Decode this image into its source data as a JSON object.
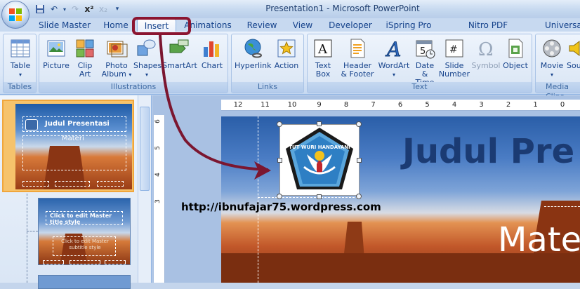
{
  "window": {
    "title": "Presentation1 - Microsoft PowerPoint"
  },
  "tabs": [
    {
      "label": "Slide Master"
    },
    {
      "label": "Home"
    },
    {
      "label": "Insert"
    },
    {
      "label": "Animations"
    },
    {
      "label": "Review"
    },
    {
      "label": "View"
    },
    {
      "label": "Developer"
    },
    {
      "label": "iSpring Pro"
    },
    {
      "label": "Nitro PDF Professional"
    },
    {
      "label": "Universal"
    }
  ],
  "active_tab": "Insert",
  "groups": {
    "tables": {
      "label": "Tables",
      "table": "Table"
    },
    "illustrations": {
      "label": "Illustrations",
      "picture": "Picture",
      "clipart1": "Clip",
      "clipart2": "Art",
      "photo1": "Photo",
      "photo2": "Album",
      "shapes": "Shapes",
      "smartart": "SmartArt",
      "chart": "Chart"
    },
    "links": {
      "label": "Links",
      "hyperlink": "Hyperlink",
      "action": "Action"
    },
    "text": {
      "label": "Text",
      "textbox1": "Text",
      "textbox2": "Box",
      "header1": "Header",
      "header2": "& Footer",
      "wordart": "WordArt",
      "datetime1": "Date",
      "datetime2": "& Time",
      "slidenum1": "Slide",
      "slidenum2": "Number",
      "symbol": "Symbol",
      "object": "Object"
    },
    "media": {
      "label": "Media Clips",
      "movie": "Movie",
      "sound": "Sou"
    }
  },
  "slides_panel": {
    "number": "1",
    "thumb1_title": "Judul Presentasi",
    "thumb1_subtitle": "Materi",
    "thumb2_title": "Click to edit Master title style",
    "thumb2_subtitle": "Click to edit Master subtitle style"
  },
  "ruler": {
    "h_labels": [
      "12",
      "11",
      "10",
      "9",
      "8",
      "7",
      "6",
      "5",
      "4",
      "3",
      "2",
      "1",
      "0"
    ],
    "v_labels": [
      "6",
      "5",
      "4",
      "3"
    ]
  },
  "slide": {
    "title": "Judul Pre",
    "subtitle": "Mate",
    "logo_text": "TUT WURI HANDAYANI"
  },
  "annotation": {
    "url": "http://ibnufajar75.wordpress.com"
  },
  "colors": {
    "highlight": "#8b1530",
    "title": "#1b3b73"
  }
}
